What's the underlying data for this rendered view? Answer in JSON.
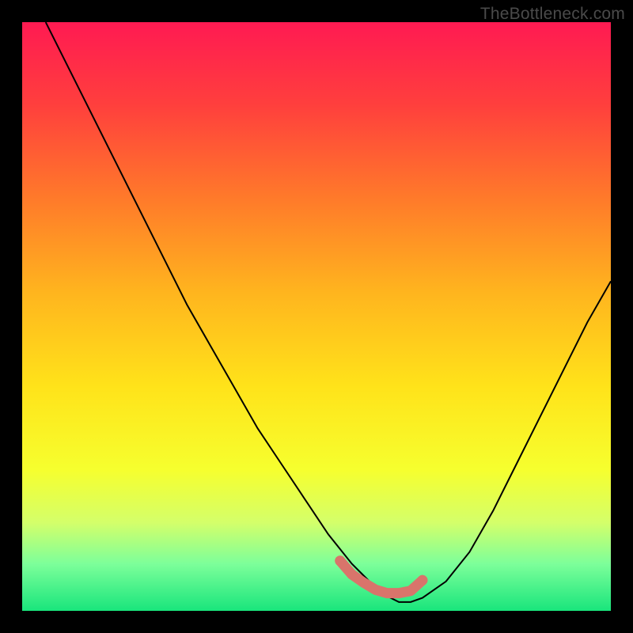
{
  "watermark": "TheBottleneck.com",
  "chart_data": {
    "type": "line",
    "title": "",
    "xlabel": "",
    "ylabel": "",
    "xlim": [
      0,
      100
    ],
    "ylim": [
      0,
      100
    ],
    "grid": false,
    "legend": false,
    "gradient_stops": [
      {
        "pct": 0,
        "color": "#ff1a52"
      },
      {
        "pct": 14,
        "color": "#ff3f3d"
      },
      {
        "pct": 30,
        "color": "#ff7a2a"
      },
      {
        "pct": 46,
        "color": "#ffb51e"
      },
      {
        "pct": 62,
        "color": "#ffe31a"
      },
      {
        "pct": 76,
        "color": "#f6ff2e"
      },
      {
        "pct": 85,
        "color": "#d4ff6a"
      },
      {
        "pct": 92,
        "color": "#7dff9a"
      },
      {
        "pct": 100,
        "color": "#19e57c"
      }
    ],
    "series": [
      {
        "name": "bottleneck-curve",
        "color": "#000000",
        "x": [
          4,
          8,
          12,
          16,
          20,
          24,
          28,
          32,
          36,
          40,
          44,
          48,
          52,
          56,
          58,
          60,
          62,
          64,
          66,
          68,
          72,
          76,
          80,
          84,
          88,
          92,
          96,
          100
        ],
        "y": [
          100,
          92,
          84,
          76,
          68,
          60,
          52,
          45,
          38,
          31,
          25,
          19,
          13,
          8,
          6,
          4,
          2.5,
          1.5,
          1.5,
          2.2,
          5,
          10,
          17,
          25,
          33,
          41,
          49,
          56
        ]
      }
    ],
    "highlight_segment": {
      "name": "optimal-zone",
      "color": "#d9746b",
      "x": [
        54,
        56,
        58,
        60,
        62,
        64,
        66,
        68
      ],
      "y": [
        8.5,
        6.2,
        4.8,
        3.6,
        3.0,
        3.0,
        3.4,
        5.2
      ],
      "endpoint_radius": 6.5
    }
  }
}
